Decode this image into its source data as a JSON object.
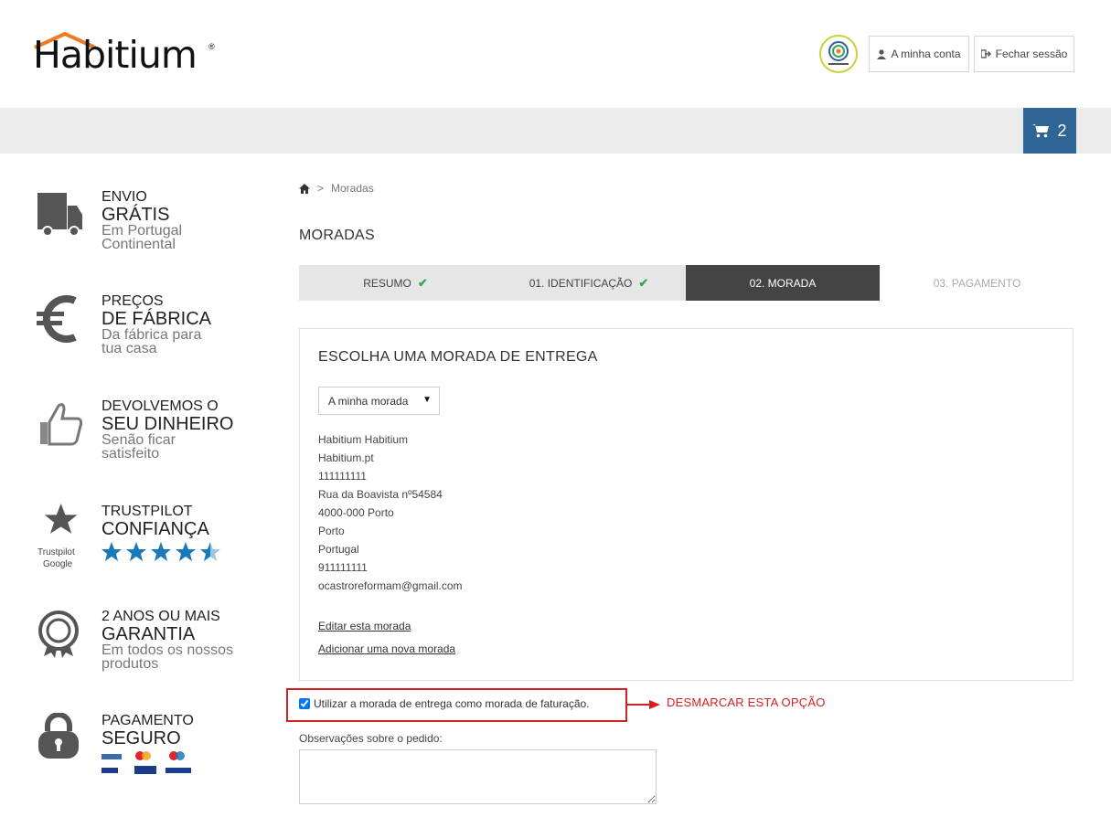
{
  "brand": {
    "logo_text": "Habitium",
    "reg": "®",
    "accent": "#f07a20"
  },
  "header": {
    "account_label": "A minha conta",
    "logout_label": "Fechar sessão",
    "cart_count": "2"
  },
  "features": [
    {
      "l1": "ENVIO",
      "l2": "GRÁTIS",
      "l3a": "Em Portugal",
      "l3b": "Continental",
      "icon": "truck-icon"
    },
    {
      "l1": "PREÇOS",
      "l2": "DE FÁBRICA",
      "l3a": "Da fábrica para",
      "l3b": "tua casa",
      "icon": "euro-icon"
    },
    {
      "l1": "DEVOLVEMOS O",
      "l2": "SEU DINHEIRO",
      "l3a": "Senão ficar",
      "l3b": "satisfeito",
      "icon": "thumbs-up-icon"
    },
    {
      "l1": "TRUSTPILOT",
      "l2": "CONFIANÇA",
      "sub1": "Trustpilot",
      "sub2": "Google",
      "rating": 4.5,
      "icon": "star-icon"
    },
    {
      "l1": "2 ANOS OU MAIS",
      "l2": "GARANTIA",
      "l3a": "Em todos os nossos",
      "l3b": "produtos",
      "icon": "award-icon"
    },
    {
      "l1": "PAGAMENTO",
      "l2": "SEGURO",
      "icon": "padlock-icon"
    }
  ],
  "breadcrumb": {
    "separator": ">",
    "current": "Moradas"
  },
  "page_title": "MORADAS",
  "steps": [
    {
      "label": "RESUMO",
      "state": "done"
    },
    {
      "label": "01. IDENTIFICAÇÃO",
      "state": "done"
    },
    {
      "label": "02. MORADA",
      "state": "active"
    },
    {
      "label": "03. PAGAMENTO",
      "state": "future"
    }
  ],
  "panel": {
    "title": "ESCOLHA UMA MORADA DE ENTREGA",
    "select_value": "A minha morada",
    "address_lines": [
      "Habitium Habitium",
      "Habitium.pt",
      "111111111",
      "Rua da Boavista nº54584",
      "4000-000 Porto",
      "Porto",
      "Portugal",
      "911111111",
      "ocastroreformam@gmail.com"
    ],
    "edit_link": "Editar esta morada",
    "add_link": "Adicionar uma nova morada"
  },
  "billing_checkbox": {
    "label": "Utilizar a morada de entrega como morada de faturação.",
    "checked": true
  },
  "annotation": {
    "text": "DESMARCAR ESTA OPÇÃO",
    "color": "#d32020"
  },
  "notes": {
    "label": "Observações sobre o pedido:"
  }
}
